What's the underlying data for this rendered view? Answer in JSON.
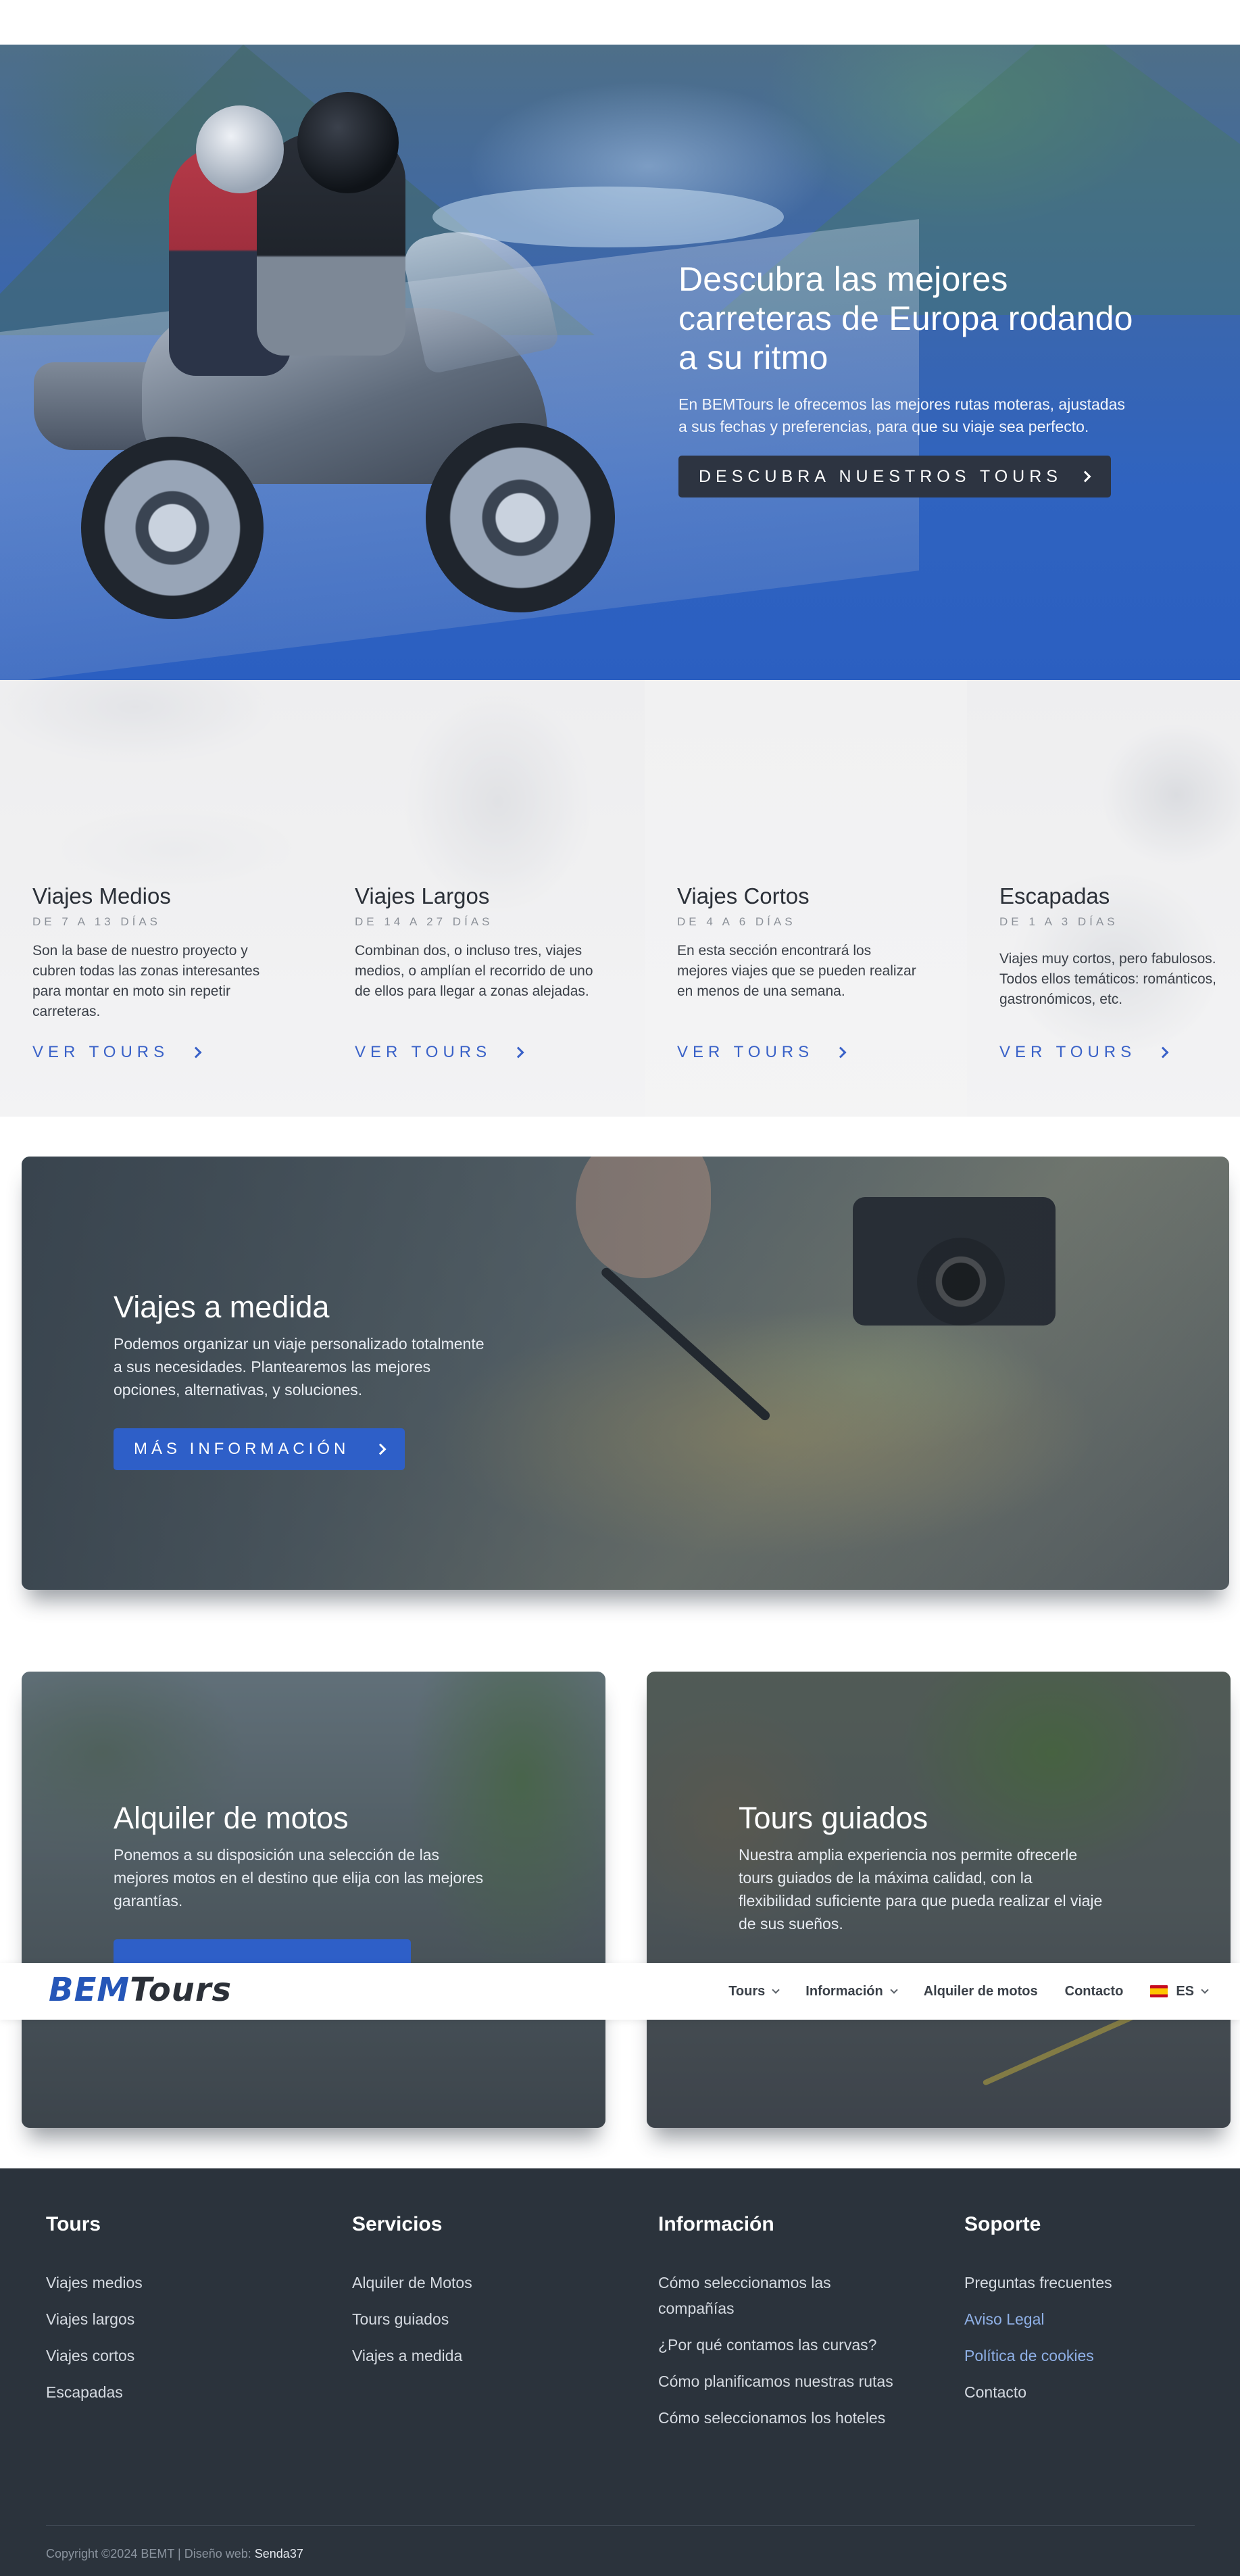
{
  "hero": {
    "title": "Descubra las mejores carreteras de Europa rodando a su ritmo",
    "description": "En BEMTours le ofrecemos las mejores rutas moteras, ajustadas a sus fechas y preferencias, para que su viaje sea perfecto.",
    "button_label": "Descubra nuestros tours"
  },
  "categories": [
    {
      "title": "Viajes Medios",
      "days": "de 7 a 13 días",
      "description": "Son la base de nuestro proyecto y cubren todas las zonas interesantes para montar en moto sin repetir carreteras.",
      "link": "VER TOURS"
    },
    {
      "title": "Viajes Largos",
      "days": "de 14 a 27 días",
      "description": "Combinan dos, o incluso tres, viajes medios, o amplían el recorrido de uno de ellos para llegar a zonas alejadas.",
      "link": "VER TOURS"
    },
    {
      "title": "Viajes Cortos",
      "days": "de 4 a 6 días",
      "description": "En esta sección encontrará los mejores viajes que se pueden realizar en menos de una semana.",
      "link": "VER TOURS"
    },
    {
      "title": "Escapadas",
      "days": "de 1 a 3 días",
      "description": "Viajes muy cortos, pero fabulosos. Todos ellos temáticos: románticos, gastronómicos, etc.",
      "link": "VER TOURS"
    }
  ],
  "medida": {
    "title": "Viajes a medida",
    "description": "Podemos organizar un viaje personalizado totalmente a sus necesidades. Plantearemos las mejores opciones, alternativas, y soluciones.",
    "button_label": "Más información"
  },
  "alquiler": {
    "title": "Alquiler de motos",
    "description": "Ponemos a su disposición una selección de las mejores motos en el destino que elija con las mejores garantías."
  },
  "guiados": {
    "title": "Tours guiados",
    "description": "Nuestra amplia experiencia nos permite ofrecerle tours guiados de la máxima calidad, con la flexibilidad suficiente para que pueda realizar el viaje de sus sueños."
  },
  "header": {
    "logo_bem": "BEM",
    "logo_tours": "Tours",
    "nav": {
      "tours": "Tours",
      "informacion": "Información",
      "alquiler": "Alquiler de motos",
      "contacto": "Contacto",
      "lang": "ES"
    }
  },
  "footer": {
    "cols": [
      {
        "title": "Tours",
        "links": [
          "Viajes medios",
          "Viajes largos",
          "Viajes cortos",
          "Escapadas"
        ]
      },
      {
        "title": "Servicios",
        "links": [
          "Alquiler de Motos",
          "Tours guiados",
          "Viajes a medida"
        ]
      },
      {
        "title": "Información",
        "links": [
          "Cómo seleccionamos las compañías",
          "¿Por qué contamos las curvas?",
          "Cómo planificamos nuestras rutas",
          "Cómo seleccionamos los hoteles"
        ]
      },
      {
        "title": "Soporte",
        "links": [
          "Preguntas frecuentes",
          "Aviso Legal",
          "Política de cookies",
          "Contacto"
        ]
      }
    ],
    "copyright": "Copyright ©2024 BEMT | Diseño web: ",
    "designer": "Senda37"
  },
  "colors": {
    "brand_blue": "#2556b8",
    "dark": "#2b333c",
    "accent_button": "#2e5fc8"
  }
}
